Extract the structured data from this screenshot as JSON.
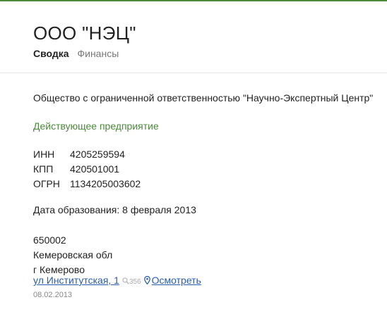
{
  "company": {
    "title": "ООО \"НЭЦ\""
  },
  "tabs": [
    {
      "label": "Сводка"
    },
    {
      "label": "Финансы"
    }
  ],
  "summary": {
    "full_name": "Общество с ограниченной ответственностью \"Научно-Экспертный Центр\"",
    "status": "Действующее предприятие",
    "ids": [
      {
        "key": "ИНН",
        "value": "4205259594"
      },
      {
        "key": "КПП",
        "value": "420501001"
      },
      {
        "key": "ОГРН",
        "value": "1134205003602"
      }
    ],
    "founded": "Дата образования: 8 февраля 2013",
    "address": {
      "postcode": "650002",
      "region": "Кемеровская обл",
      "city": "г Кемерово",
      "street_link": "ул Институтская, 1",
      "views": "356",
      "view_link": "Осмотреть",
      "date": "08.02.2013"
    }
  },
  "colors": {
    "accent_green": "#4a8a3a",
    "link_blue": "#2a5db0"
  },
  "icons": {
    "views": "search-icon",
    "map": "map-pin-icon"
  }
}
